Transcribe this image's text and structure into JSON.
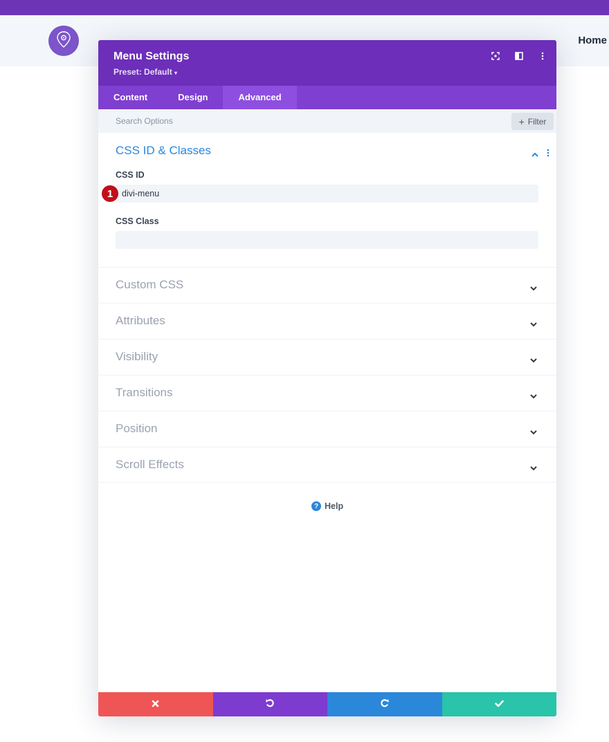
{
  "site": {
    "nav_home": "Home",
    "icons": {
      "logo": "map-pin-icon"
    },
    "colors": {
      "topbar": "#6d34b8",
      "header": "#f3f6fa",
      "logo": "#7b55c9"
    }
  },
  "modal": {
    "title": "Menu Settings",
    "preset": "Preset: Default",
    "header_icons": [
      "expand-icon",
      "split-view-icon",
      "more-vertical-icon"
    ],
    "tabs": [
      {
        "label": "Content",
        "active": false
      },
      {
        "label": "Design",
        "active": false
      },
      {
        "label": "Advanced",
        "active": true
      }
    ],
    "search": {
      "placeholder": "Search Options",
      "filter_label": "Filter"
    },
    "section": {
      "title": "CSS ID & Classes",
      "expanded": true,
      "fields": [
        {
          "label": "CSS ID",
          "value": "divi-menu"
        },
        {
          "label": "CSS Class",
          "value": ""
        }
      ]
    },
    "annotation_badge": "1",
    "toggles": [
      {
        "label": "Custom CSS"
      },
      {
        "label": "Attributes"
      },
      {
        "label": "Visibility"
      },
      {
        "label": "Transitions"
      },
      {
        "label": "Position"
      },
      {
        "label": "Scroll Effects"
      }
    ],
    "help_label": "Help",
    "footer_buttons": [
      {
        "name": "cancel",
        "icon": "close-icon",
        "color": "#ef5555"
      },
      {
        "name": "undo",
        "icon": "undo-icon",
        "color": "#7e3bd0"
      },
      {
        "name": "redo",
        "icon": "redo-icon",
        "color": "#2b87da"
      },
      {
        "name": "save",
        "icon": "check-icon",
        "color": "#29c4a9"
      }
    ],
    "colors": {
      "header": "#6d2eba",
      "tabs": "#7f3fd0",
      "active_tab": "#8e4fe0",
      "section_title": "#2b87da",
      "badge": "#c0101a"
    }
  }
}
